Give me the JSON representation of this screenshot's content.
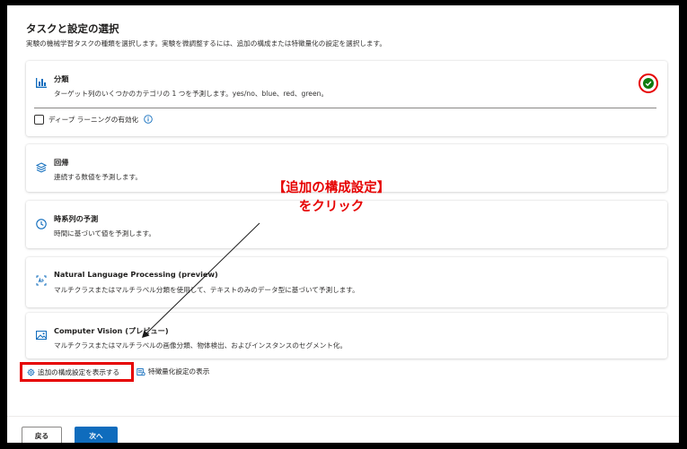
{
  "page": {
    "title": "タスクと設定の選択",
    "subtitle": "実験の機械学習タスクの種類を選択します。実験を微調整するには、追加の構成または特徴量化の設定を選択します。"
  },
  "tasks": [
    {
      "title": "分類",
      "description": "ターゲット列のいくつかのカテゴリの 1 つを予測します。yes/no、blue、red、green。",
      "icon": "bar-chart-icon",
      "selected": true
    },
    {
      "title": "回帰",
      "description": "連続する数値を予測します。",
      "icon": "stack-icon"
    },
    {
      "title": "時系列の予測",
      "description": "時間に基づいて値を予測します。",
      "icon": "clock-icon"
    },
    {
      "title": "Natural Language Processing (preview)",
      "description": "マルチクラスまたはマルチラベル分類を使用して、テキストのみのデータ型に基づいて予測します。",
      "icon": "text-box-icon"
    },
    {
      "title": "Computer Vision (プレビュー)",
      "description": "マルチクラスまたはマルチラベルの画像分類、物体検出、およびインスタンスのセグメント化。",
      "icon": "image-icon"
    }
  ],
  "deep_learning": {
    "label": "ディープ ラーニングの有効化",
    "checked": false
  },
  "links": {
    "additional_config": "追加の構成設定を表示する",
    "featurization": "特徴量化設定の表示"
  },
  "footer": {
    "back": "戻る",
    "next": "次へ"
  },
  "annotation": {
    "line1": "【追加の構成設定】",
    "line2": "をクリック"
  },
  "colors": {
    "accent": "#0f6cbd",
    "highlight": "#e60000",
    "success": "#107c10"
  }
}
